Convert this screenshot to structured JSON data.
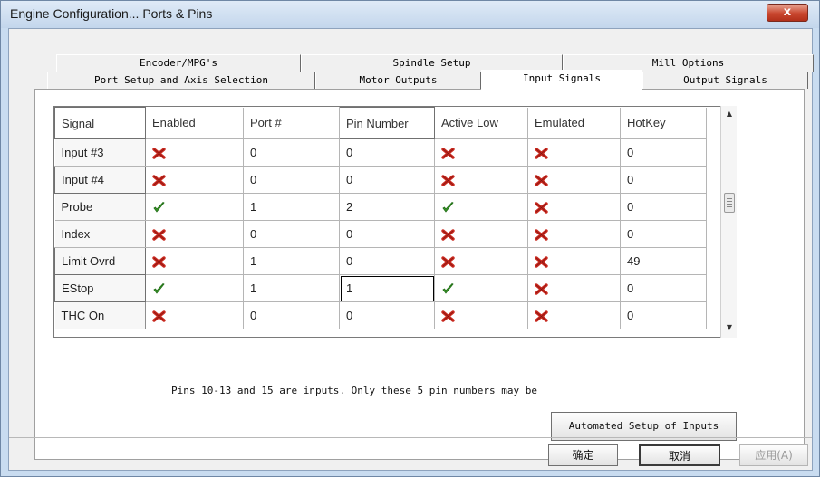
{
  "window": {
    "title": "Engine Configuration... Ports & Pins",
    "close_label": "x"
  },
  "tabs_row1": [
    {
      "label": "Encoder/MPG's"
    },
    {
      "label": "Spindle Setup"
    },
    {
      "label": "Mill Options"
    }
  ],
  "tabs_row2": [
    {
      "label": "Port Setup and Axis Selection"
    },
    {
      "label": "Motor Outputs"
    },
    {
      "label": "Input Signals",
      "active": true
    },
    {
      "label": "Output Signals"
    }
  ],
  "grid": {
    "columns": [
      "Signal",
      "Enabled",
      "Port #",
      "Pin Number",
      "Active Low",
      "Emulated",
      "HotKey"
    ],
    "rows": [
      {
        "signal": "Input #3",
        "enabled": false,
        "port": "0",
        "pin": "0",
        "active_low": false,
        "emulated": false,
        "hotkey": "0"
      },
      {
        "signal": "Input #4",
        "enabled": false,
        "port": "0",
        "pin": "0",
        "active_low": false,
        "emulated": false,
        "hotkey": "0"
      },
      {
        "signal": "Probe",
        "enabled": true,
        "port": "1",
        "pin": "2",
        "active_low": true,
        "emulated": false,
        "hotkey": "0"
      },
      {
        "signal": "Index",
        "enabled": false,
        "port": "0",
        "pin": "0",
        "active_low": false,
        "emulated": false,
        "hotkey": "0"
      },
      {
        "signal": "Limit Ovrd",
        "enabled": false,
        "port": "1",
        "pin": "0",
        "active_low": false,
        "emulated": false,
        "hotkey": "49"
      },
      {
        "signal": "EStop",
        "enabled": true,
        "port": "1",
        "pin": "1",
        "active_low": true,
        "emulated": false,
        "hotkey": "0"
      },
      {
        "signal": "THC On",
        "enabled": false,
        "port": "0",
        "pin": "0",
        "active_low": false,
        "emulated": false,
        "hotkey": "0"
      }
    ],
    "selected_cell": {
      "row": 5,
      "column": "Pin Number"
    }
  },
  "icons": {
    "check": "green-check-icon",
    "cross": "red-x-icon",
    "check_color": "#3a9a2a",
    "cross_color": "#c8281e"
  },
  "note": "Pins 10-13 and 15 are inputs. Only these 5 pin numbers may be",
  "buttons": {
    "automated_setup": "Automated Setup of Inputs",
    "ok": "确定",
    "cancel": "取消",
    "apply": "应用(A)"
  }
}
